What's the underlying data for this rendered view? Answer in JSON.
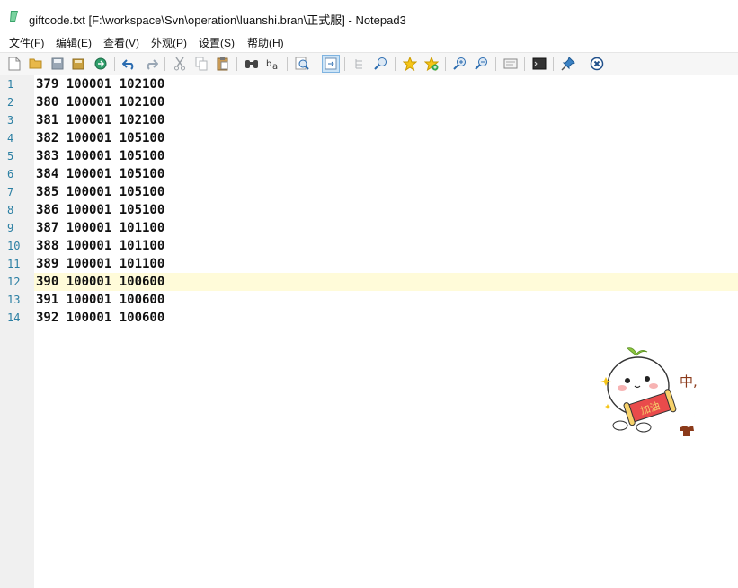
{
  "window": {
    "title": "giftcode.txt [F:\\workspace\\Svn\\operation\\luanshi.bran\\正式服] - Notepad3",
    "icon": "notepad3-icon"
  },
  "menu": [
    "文件(F)",
    "编辑(E)",
    "查看(V)",
    "外观(P)",
    "设置(S)",
    "帮助(H)"
  ],
  "toolbar": [
    {
      "name": "new-file-icon"
    },
    {
      "name": "open-folder-icon"
    },
    {
      "name": "save-icon"
    },
    {
      "name": "save-as-icon"
    },
    {
      "name": "browse-icon"
    },
    {
      "name": "undo-icon"
    },
    {
      "name": "redo-icon"
    },
    {
      "name": "cut-icon"
    },
    {
      "name": "copy-icon"
    },
    {
      "name": "paste-icon"
    },
    {
      "name": "find-icon"
    },
    {
      "name": "replace-icon"
    },
    {
      "name": "goto-icon"
    },
    {
      "name": "word-wrap-icon",
      "pressed": true
    },
    {
      "name": "toggle-fold-icon"
    },
    {
      "name": "find-in-files-icon"
    },
    {
      "name": "add-favorite-icon"
    },
    {
      "name": "favorites-icon"
    },
    {
      "name": "zoom-in-icon"
    },
    {
      "name": "zoom-out-icon"
    },
    {
      "name": "scheme-icon"
    },
    {
      "name": "console-icon"
    },
    {
      "name": "pin-icon"
    },
    {
      "name": "close-icon"
    }
  ],
  "editor": {
    "current_line": 12,
    "lines": [
      {
        "no": "1",
        "text": "379 100001 102100"
      },
      {
        "no": "2",
        "text": "380 100001 102100"
      },
      {
        "no": "3",
        "text": "381 100001 102100"
      },
      {
        "no": "4",
        "text": "382 100001 105100"
      },
      {
        "no": "5",
        "text": "383 100001 105100"
      },
      {
        "no": "6",
        "text": "384 100001 105100"
      },
      {
        "no": "7",
        "text": "385 100001 105100"
      },
      {
        "no": "8",
        "text": "386 100001 105100"
      },
      {
        "no": "9",
        "text": "387 100001 101100"
      },
      {
        "no": "10",
        "text": "388 100001 101100"
      },
      {
        "no": "11",
        "text": "389 100001 101100"
      },
      {
        "no": "12",
        "text": "390 100001 100600"
      },
      {
        "no": "13",
        "text": "391 100001 100600"
      },
      {
        "no": "14",
        "text": "392 100001 100600"
      }
    ]
  },
  "sticker": {
    "scroll_text": "加油",
    "side_text": "中,"
  }
}
